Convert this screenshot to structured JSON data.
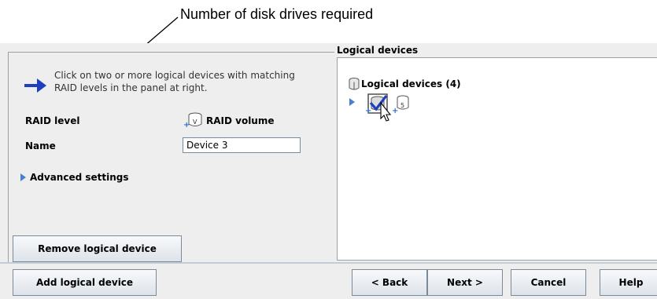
{
  "callout": {
    "text": "Number of disk drives required"
  },
  "instructions": {
    "text": "Click on two or more logical devices with matching RAID levels in the panel at right."
  },
  "form": {
    "raid_level_label": "RAID level",
    "raid_level_value": "RAID volume",
    "raid_icon_badge": "V",
    "name_label": "Name",
    "name_value": "Device 3",
    "advanced_label": "Advanced settings"
  },
  "logical_devices": {
    "panel_title": "Logical devices",
    "tree_root_label": "Logical devices (4)",
    "disk_badge": "5"
  },
  "buttons": {
    "remove": "Remove logical device",
    "add": "Add logical device",
    "back": "< Back",
    "next": "Next >",
    "cancel": "Cancel",
    "help": "Help"
  },
  "colors": {
    "accent": "#1f3fbf",
    "panel_bg": "#eeeeee",
    "border": "#9aa0a8",
    "tree_arrow": "#4a7fd0"
  }
}
